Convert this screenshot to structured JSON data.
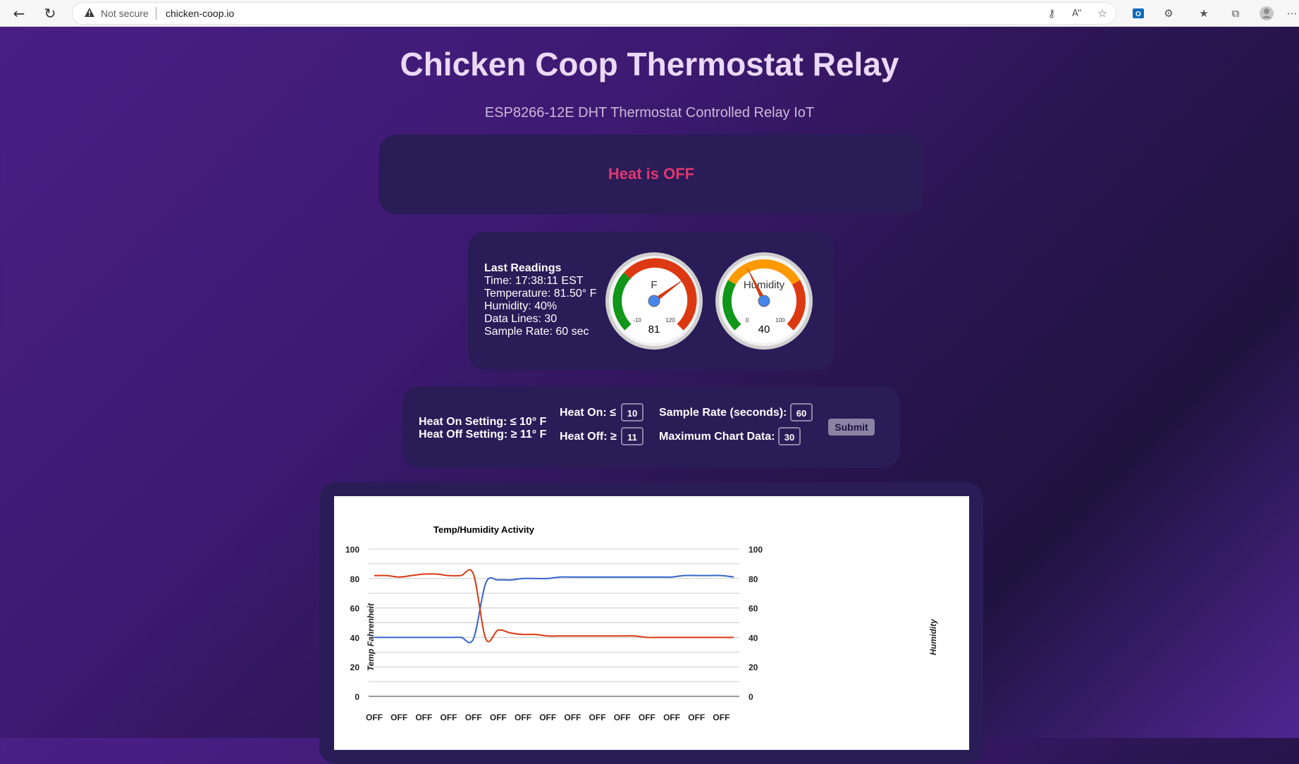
{
  "browser": {
    "security_text": "Not secure",
    "url": "chicken-coop.io"
  },
  "page": {
    "title": "Chicken Coop Thermostat Relay",
    "subtitle": "ESP8266-12E DHT Thermostat Controlled Relay IoT"
  },
  "status": {
    "text": "Heat is OFF",
    "color": "#e0376f"
  },
  "readings": {
    "heading": "Last Readings",
    "time": "Time: 17:38:11 EST",
    "temperature": "Temperature: 81.50° F",
    "humidity": "Humidity: 40%",
    "data_lines": "Data Lines: 30",
    "sample_rate": "Sample Rate: 60 sec"
  },
  "gauges": {
    "temp": {
      "label": "F",
      "value": 81,
      "display": "81",
      "min": -10,
      "max": 120,
      "min_label": "-10",
      "max_label": "120"
    },
    "humidity": {
      "label": "Humidity",
      "value": 40,
      "display": "40",
      "min": 0,
      "max": 100,
      "min_label": "0",
      "max_label": "100"
    }
  },
  "settings": {
    "heat_on_setting": "Heat On Setting: ≤ 10° F",
    "heat_off_setting": "Heat Off Setting: ≥ 11° F",
    "heat_on_label": "Heat On: ≤",
    "heat_on_value": "10",
    "heat_off_label": "Heat Off: ≥",
    "heat_off_value": "11",
    "sample_rate_label": "Sample Rate (seconds):",
    "sample_rate_value": "60",
    "max_chart_label": "Maximum Chart Data:",
    "max_chart_value": "30",
    "submit_label": "Submit"
  },
  "chart_data": {
    "type": "line",
    "title": "Temp/Humidity Activity",
    "ylabel": "Temp Fahrenheit",
    "y2label": "Humidity",
    "ylim": [
      0,
      100
    ],
    "y2lim": [
      0,
      100
    ],
    "yticks": [
      "0",
      "20",
      "40",
      "60",
      "80",
      "100"
    ],
    "categories": [
      "OFF",
      "OFF",
      "OFF",
      "OFF",
      "OFF",
      "OFF",
      "OFF",
      "OFF",
      "OFF",
      "OFF",
      "OFF",
      "OFF",
      "OFF",
      "OFF",
      "OFF",
      "OFF",
      "OFF",
      "OFF",
      "OFF",
      "OFF",
      "OFF",
      "OFF",
      "OFF",
      "OFF",
      "OFF",
      "OFF",
      "OFF",
      "OFF",
      "OFF",
      "OFF"
    ],
    "series": [
      {
        "color": "#3366cc",
        "axis": "right",
        "values": [
          40,
          40,
          40,
          40,
          40,
          40,
          40,
          40,
          39,
          77,
          79,
          79,
          80,
          80,
          80,
          81,
          81,
          81,
          81,
          81,
          81,
          81,
          81,
          81,
          81,
          82,
          82,
          82,
          82,
          81
        ]
      },
      {
        "color": "#dc3912",
        "axis": "left",
        "values": [
          82,
          82,
          81,
          82,
          83,
          83,
          82,
          82,
          83,
          39,
          45,
          43,
          42,
          42,
          41,
          41,
          41,
          41,
          41,
          41,
          41,
          41,
          40,
          40,
          40,
          40,
          40,
          40,
          40,
          40
        ]
      }
    ],
    "grid": true
  }
}
